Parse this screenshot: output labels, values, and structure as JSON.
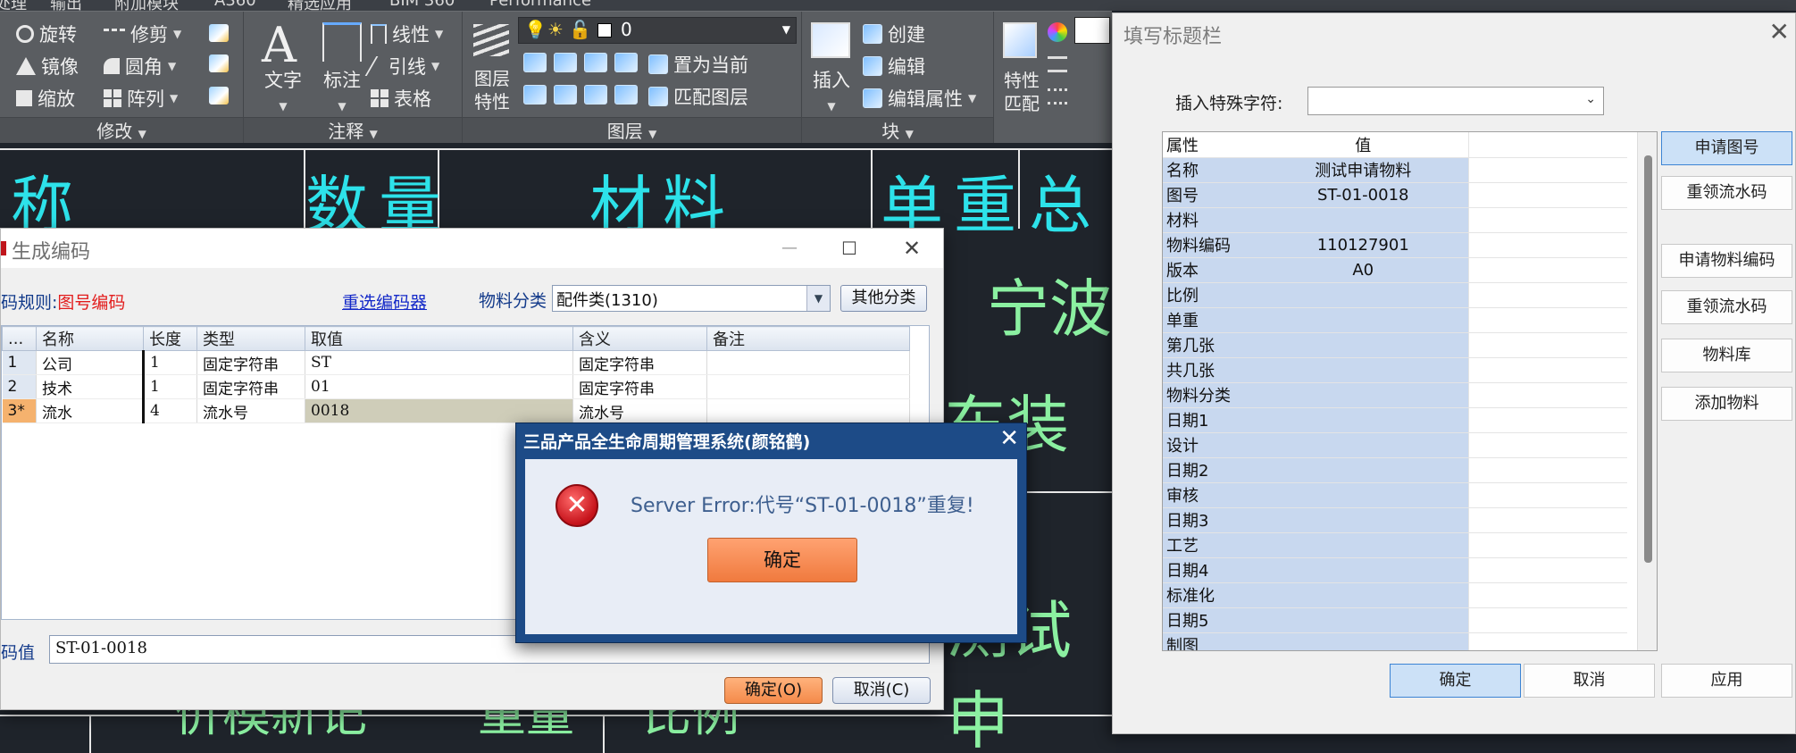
{
  "menubar": [
    "处理",
    "输出",
    "附加模块",
    "A360",
    "精选应用",
    "BIM 360",
    "Performance"
  ],
  "ribbon": {
    "modify": {
      "items": [
        "旋转",
        "修剪",
        "镜像",
        "圆角",
        "缩放",
        "阵列"
      ],
      "title": "修改"
    },
    "annotation": {
      "text": "文字",
      "dim": "标注",
      "linear": "线性",
      "leader": "引线",
      "table": "表格",
      "title": "注释"
    },
    "layers": {
      "props": "图层\n特性",
      "props1": "图层",
      "props2": "特性",
      "current_layer": "0",
      "set_current": "置为当前",
      "match": "匹配图层",
      "title": "图层"
    },
    "block": {
      "insert": "插入",
      "create": "创建",
      "edit": "编辑",
      "edit_attr": "编辑属性",
      "title": "块"
    },
    "properties": {
      "label1": "特性",
      "label2": "匹配"
    }
  },
  "drawing": {
    "headers": [
      "称",
      "数量",
      "材料",
      "单重",
      "总"
    ],
    "green_texts": [
      "宁波",
      "东装备",
      "测试申",
      "价模新记",
      "重量",
      "比例"
    ]
  },
  "gen_dialog": {
    "title": "生成编码",
    "rule_label": "码规则:",
    "rule_value": "图号编码",
    "reselect": "重选编码器",
    "category_label": "物料分类",
    "category_value": "配件类(1310)",
    "other_category": "其他分类",
    "columns": [
      "...",
      "名称",
      "长度",
      "类型",
      "取值",
      "含义",
      "备注"
    ],
    "rows": [
      {
        "idx": "1",
        "name": "公司",
        "len": "1",
        "type": "固定字符串",
        "value": "ST",
        "meaning": "固定字符串",
        "note": ""
      },
      {
        "idx": "2",
        "name": "技术",
        "len": "1",
        "type": "固定字符串",
        "value": "01",
        "meaning": "固定字符串",
        "note": ""
      },
      {
        "idx": "3*",
        "name": "流水",
        "len": "4",
        "type": "流水号",
        "value": "0018",
        "meaning": "流水号",
        "note": ""
      }
    ],
    "code_label": "码值",
    "code_value": "ST-01-0018",
    "ok": "确定(O)",
    "cancel": "取消(C)"
  },
  "error_dialog": {
    "title": "三品产品全生命周期管理系统(颜铭鹤)",
    "message": "Server Error:代号“ST-01-0018”重复!",
    "ok": "确定"
  },
  "title_block": {
    "title": "填写标题栏",
    "insert_label": "插入特殊字符:",
    "insert_value": "",
    "col_attr": "属性",
    "col_value": "值",
    "rows": [
      {
        "k": "名称",
        "v": "测试申请物料"
      },
      {
        "k": "图号",
        "v": "ST-01-0018"
      },
      {
        "k": "材料",
        "v": ""
      },
      {
        "k": "物料编码",
        "v": "110127901"
      },
      {
        "k": "版本",
        "v": "A0"
      },
      {
        "k": "比例",
        "v": ""
      },
      {
        "k": "单重",
        "v": ""
      },
      {
        "k": "第几张",
        "v": ""
      },
      {
        "k": "共几张",
        "v": ""
      },
      {
        "k": "物料分类",
        "v": ""
      },
      {
        "k": "日期1",
        "v": ""
      },
      {
        "k": "设计",
        "v": ""
      },
      {
        "k": "日期2",
        "v": ""
      },
      {
        "k": "审核",
        "v": ""
      },
      {
        "k": "日期3",
        "v": ""
      },
      {
        "k": "工艺",
        "v": ""
      },
      {
        "k": "日期4",
        "v": ""
      },
      {
        "k": "标准化",
        "v": ""
      },
      {
        "k": "日期5",
        "v": ""
      },
      {
        "k": "制图",
        "v": ""
      }
    ],
    "side_buttons": [
      "申请图号",
      "重领流水码",
      "申请物料编码",
      "重领流水码",
      "物料库",
      "添加物料"
    ],
    "ok": "确定",
    "cancel": "取消",
    "apply": "应用"
  }
}
